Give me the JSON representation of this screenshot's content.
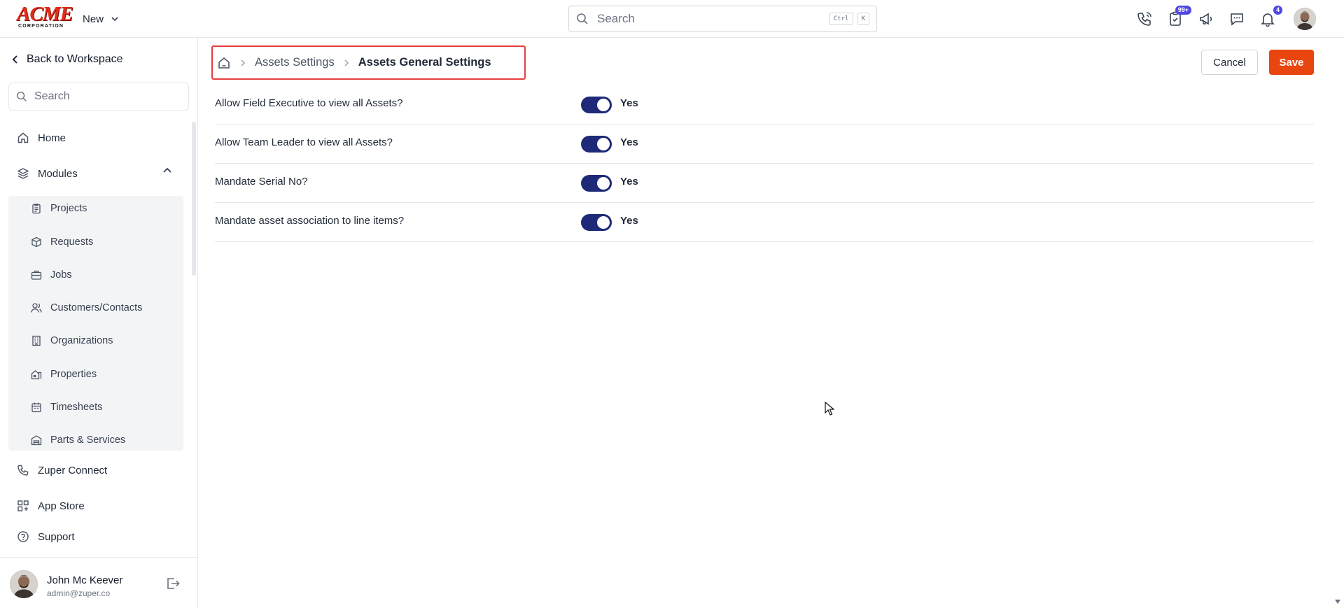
{
  "brand": {
    "logo_main": "ACME",
    "logo_sub": "CORPORATION",
    "color": "#e02d1b"
  },
  "topbar": {
    "new_label": "New",
    "search_placeholder": "Search",
    "shortcut_keys": [
      "Ctrl",
      "K"
    ],
    "icons": [
      {
        "name": "phone-icon",
        "badge": ""
      },
      {
        "name": "clipboard-check-icon",
        "badge": "99+"
      },
      {
        "name": "megaphone-icon",
        "badge": ""
      },
      {
        "name": "chat-icon",
        "badge": ""
      },
      {
        "name": "bell-icon",
        "badge": "4"
      }
    ]
  },
  "sidebar": {
    "back_label": "Back to Workspace",
    "search_placeholder": "Search",
    "home_label": "Home",
    "modules_label": "Modules",
    "modules_items": [
      {
        "label": "Projects",
        "icon": "clipboard-icon"
      },
      {
        "label": "Requests",
        "icon": "box-icon"
      },
      {
        "label": "Jobs",
        "icon": "briefcase-icon"
      },
      {
        "label": "Customers/Contacts",
        "icon": "users-icon"
      },
      {
        "label": "Organizations",
        "icon": "building-icon"
      },
      {
        "label": "Properties",
        "icon": "property-icon"
      },
      {
        "label": "Timesheets",
        "icon": "calendar-icon"
      },
      {
        "label": "Parts & Services",
        "icon": "warehouse-icon"
      }
    ],
    "bottom_items": [
      {
        "label": "Zuper Connect",
        "icon": "phone-icon"
      },
      {
        "label": "App Store",
        "icon": "grid-icon"
      },
      {
        "label": "Support",
        "icon": "help-icon"
      }
    ],
    "user": {
      "name": "John Mc Keever",
      "email": "admin@zuper.co"
    }
  },
  "breadcrumb": {
    "home_icon": "home-icon",
    "parent": "Assets Settings",
    "current": "Assets General Settings"
  },
  "actions": {
    "cancel_label": "Cancel",
    "save_label": "Save",
    "save_color": "#e8450f"
  },
  "settings": [
    {
      "label": "Allow Field Executive to view all Assets?",
      "enabled": true,
      "value_text": "Yes"
    },
    {
      "label": "Allow Team Leader to view all Assets?",
      "enabled": true,
      "value_text": "Yes"
    },
    {
      "label": "Mandate Serial No?",
      "enabled": true,
      "value_text": "Yes"
    },
    {
      "label": "Mandate asset association to line items?",
      "enabled": true,
      "value_text": "Yes"
    }
  ],
  "colors": {
    "toggle_on": "#1e2a78",
    "badge": "#4f46e5",
    "highlight_border": "#e53e3e"
  }
}
